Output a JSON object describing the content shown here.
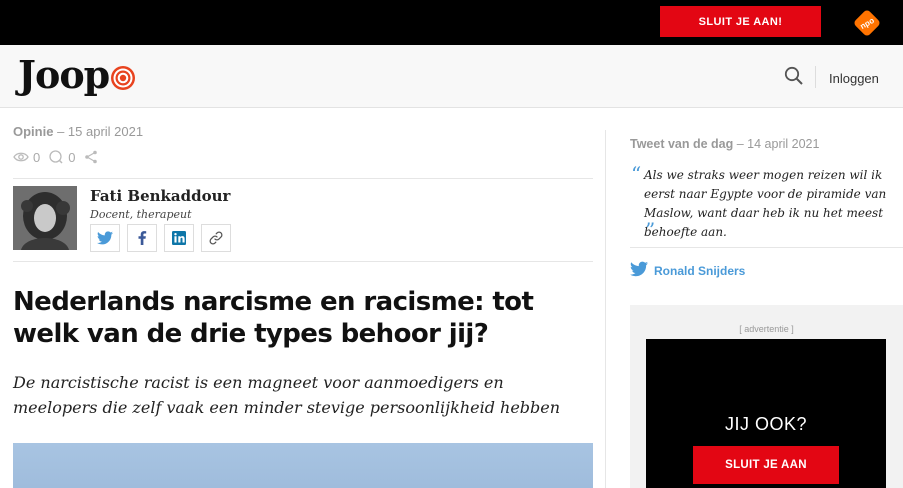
{
  "topbar": {
    "join_label": "SLUIT JE AAN!",
    "brand_icon": "npo-logo",
    "accent": "#e30613"
  },
  "header": {
    "logo_text": "Joop",
    "login_label": "Inloggen"
  },
  "article": {
    "category": "Opinie",
    "date": "– 15 april 2021",
    "views": "0",
    "comments": "0",
    "author": {
      "name": "Fati Benkaddour",
      "role": "Docent, therapeut"
    },
    "title": "Nederlands narcisme en racisme: tot welk van de drie types behoor jij?",
    "lead": "De narcistische racist is een magneet voor aanmoedigers en meelopers die zelf vaak een minder stevige persoonlijkheid hebben"
  },
  "sidebar": {
    "tweet_label": "Tweet van de dag",
    "tweet_date": "– 14 april 2021",
    "tweet_text": "Als we straks weer mogen reizen wil ik eerst naar Egypte voor de piramide van Maslow, want daar heb ik nu het meest behoefte aan.",
    "tweet_author": "Ronald Snijders",
    "twitter_color": "#4a9ad8"
  },
  "ad": {
    "label": "[ advertentie ]",
    "headline": "JIJ OOK?",
    "button": "SLUIT JE AAN"
  }
}
